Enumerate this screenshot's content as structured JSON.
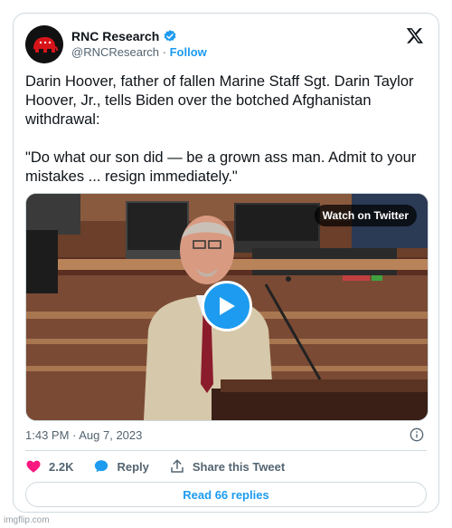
{
  "author": {
    "name": "RNC Research",
    "handle": "@RNCResearch",
    "separator": "·",
    "follow_label": "Follow"
  },
  "tweet": {
    "paragraph1": "Darin Hoover, father of fallen Marine Staff Sgt. Darin Taylor Hoover, Jr., tells Biden over the botched Afghanistan withdrawal:",
    "paragraph2": "\"Do what our son did — be a grown ass man. Admit to your mistakes ... resign immediately.\""
  },
  "media": {
    "watch_label": "Watch on Twitter",
    "play_icon": "play-icon"
  },
  "timestamp": "1:43 PM · Aug 7, 2023",
  "actions": {
    "likes_count": "2.2K",
    "reply_label": "Reply",
    "share_label": "Share this Tweet"
  },
  "read_replies_label": "Read 66 replies",
  "watermark": "imgflip.com",
  "colors": {
    "accent": "#1d9bf0",
    "like": "#f91880",
    "text": "#0f1419",
    "muted": "#536471",
    "border": "#cfd9de"
  }
}
